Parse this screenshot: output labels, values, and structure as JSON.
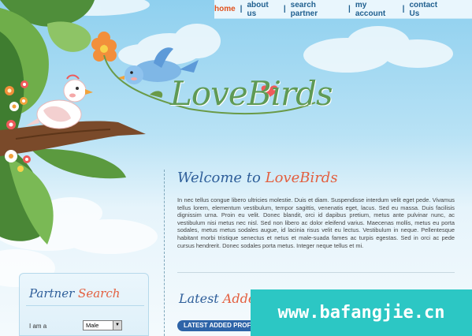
{
  "nav": {
    "items": [
      {
        "label": "home",
        "active": true
      },
      {
        "label": "about us",
        "active": false
      },
      {
        "label": "search partner",
        "active": false
      },
      {
        "label": "my account",
        "active": false
      },
      {
        "label": "contact Us",
        "active": false
      }
    ],
    "separator": "|"
  },
  "logo": {
    "text": "LoveBirds"
  },
  "welcome": {
    "prefix": "Welcome to ",
    "accent": "LoveBirds"
  },
  "body_text": "In nec tellus congue libero ultricies molestie. Duis et diam. Suspendisse interdum velit eget pede. Vivamus tellus lorem, elementum vestibulum, tempor sagittis, venenatis eget, lacus. Sed eu massa. Duis facilisis dignissim urna. Proin eu velit. Donec blandit, orci id dapibus pretium, metus ante pulvinar nunc, ac vestibulum nisi metus nec nisl. Sed non libero ac dolor eleifend varius. Maecenas mollis, metus eu porta sodales, metus metus sodales augue, id lacinia risus velit eu lectus. Vestibulum in neque. Pellentesque habitant morbi tristique senectus et netus et male-suada fames ac turpis egestas. Sed in orci ac pede cursus hendrerit. Donec sodales porta metus. Integer neque tellus et mi.",
  "latest": {
    "prefix": "Latest ",
    "accent": "Adde"
  },
  "latest_bar": {
    "label": "LATEST ADDED PROF"
  },
  "partner": {
    "title_prefix": "Partner ",
    "title_accent": "Search",
    "iam_label": "I am a",
    "iam_value": "Male"
  },
  "watermark": {
    "text": "www.bafangjie.cn"
  },
  "colors": {
    "accent": "#e35f3f",
    "title_blue": "#2f5f9a",
    "nav_active": "#e0521e",
    "watermark_bg": "#2cc7c4"
  }
}
